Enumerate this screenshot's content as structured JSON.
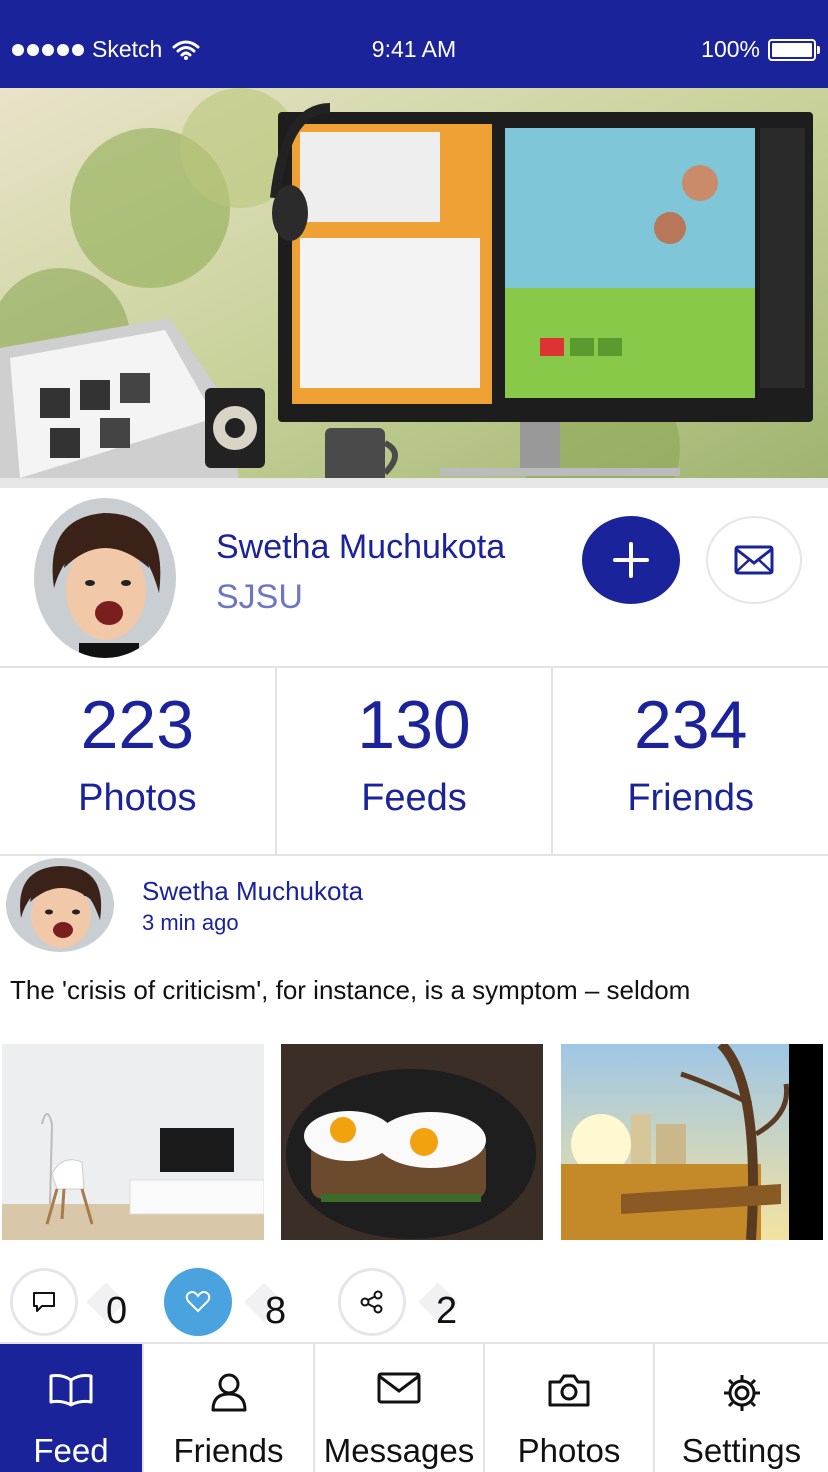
{
  "status_bar": {
    "carrier": "Sketch",
    "time": "9:41 AM",
    "battery": "100%"
  },
  "profile": {
    "name": "Swetha Muchukota",
    "school": "SJSU",
    "add_icon": "plus-icon",
    "message_icon": "envelope-icon"
  },
  "stats": [
    {
      "value": "223",
      "label": "Photos"
    },
    {
      "value": "130",
      "label": "Feeds"
    },
    {
      "value": "234",
      "label": "Friends"
    }
  ],
  "post": {
    "author": "Swetha Muchukota",
    "time": "3 min ago",
    "text": "The 'crisis of criticism', for instance, is a symptom – seldom",
    "actions": [
      {
        "icon": "comment-icon",
        "count": "0"
      },
      {
        "icon": "heart-icon",
        "count": "8"
      },
      {
        "icon": "share-icon",
        "count": "2"
      }
    ]
  },
  "tabs": [
    {
      "label": "Feed",
      "icon": "book-icon",
      "active": true
    },
    {
      "label": "Friends",
      "icon": "person-icon",
      "active": false
    },
    {
      "label": "Messages",
      "icon": "envelope-icon",
      "active": false
    },
    {
      "label": "Photos",
      "icon": "camera-icon",
      "active": false
    },
    {
      "label": "Settings",
      "icon": "gear-icon",
      "active": false
    }
  ],
  "colors": {
    "brand": "#1a2399",
    "accent_blue": "#4aa3df",
    "muted_blue": "#6d76c4"
  }
}
